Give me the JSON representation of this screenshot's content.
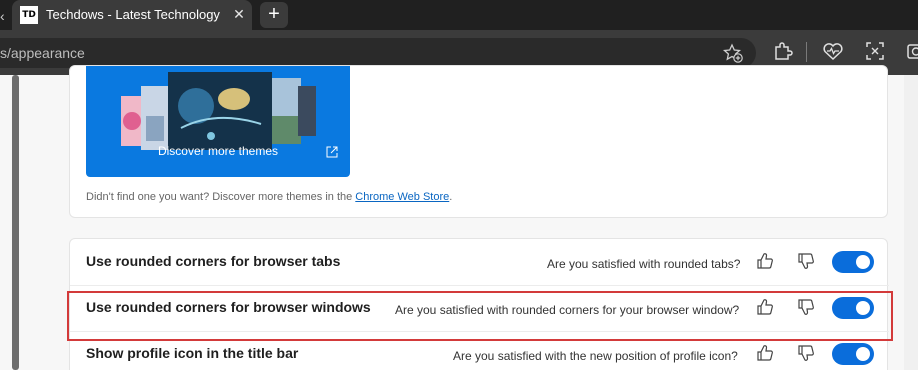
{
  "browser": {
    "tab": {
      "favicon_text": "TD",
      "title": "Techdows - Latest Technology Ne",
      "close_icon": "close-icon"
    },
    "new_tab_icon": "plus-icon",
    "address_bar": {
      "url": "s/appearance"
    }
  },
  "themes": {
    "banner_label": "Discover more themes",
    "discover_prefix": "Didn't find one you want? Discover more themes in the ",
    "discover_link": "Chrome Web Store",
    "discover_suffix": "."
  },
  "settings": {
    "rows": [
      {
        "label": "Use rounded corners for browser tabs",
        "question": "Are you satisfied with rounded tabs?",
        "enabled": true
      },
      {
        "label": "Use rounded corners for browser windows",
        "question": "Are you satisfied with rounded corners for your browser window?",
        "enabled": true,
        "highlighted": true
      },
      {
        "label": "Show profile icon in the title bar",
        "question": "Are you satisfied with the new position of profile icon?",
        "enabled": true
      }
    ]
  },
  "colors": {
    "toggle_on": "#0a6ddb",
    "highlight_border": "#d33a3a",
    "link": "#0a66c2"
  }
}
